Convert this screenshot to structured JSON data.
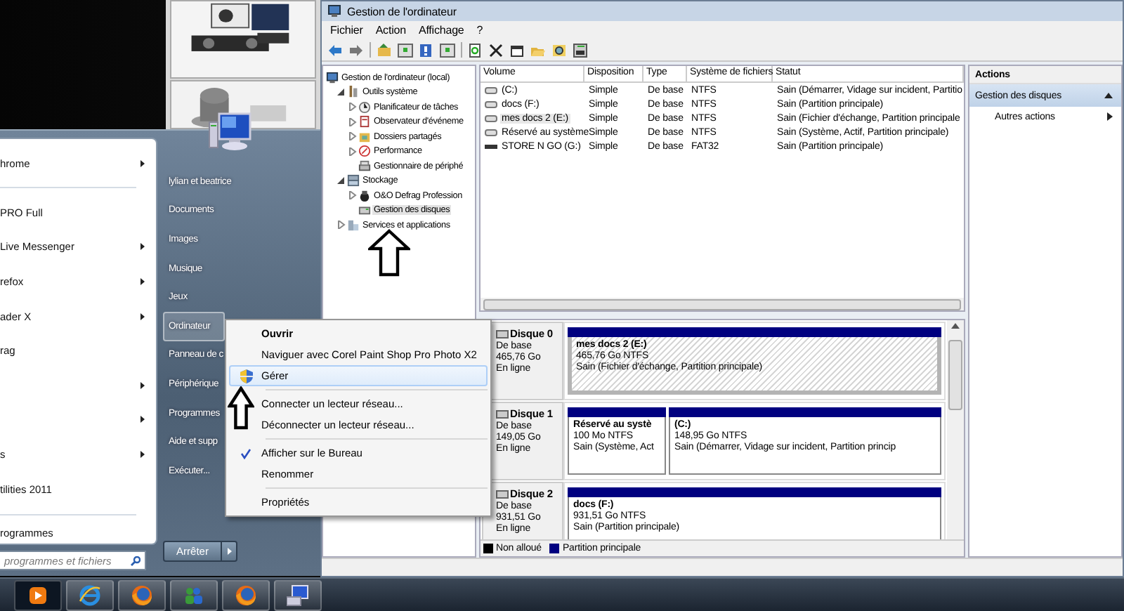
{
  "window": {
    "title": "Gestion de l'ordinateur",
    "menu": [
      "Fichier",
      "Action",
      "Affichage",
      "?"
    ],
    "tree": [
      {
        "label": "Gestion de l'ordinateur (local)",
        "selected": false,
        "children": [
          {
            "label": "Outils système",
            "expanded": true,
            "selected": false,
            "children": [
              {
                "label": "Planificateur de tâches",
                "expanded": false,
                "selected": false
              },
              {
                "label": "Observateur d'événeme",
                "expanded": false,
                "selected": false
              },
              {
                "label": "Dossiers partagés",
                "expanded": false,
                "selected": false
              },
              {
                "label": "Performance",
                "expanded": false,
                "selected": false
              },
              {
                "label": "Gestionnaire de périphé",
                "selected": false
              }
            ]
          },
          {
            "label": "Stockage",
            "expanded": true,
            "selected": false,
            "children": [
              {
                "label": "O&O Defrag Profession",
                "expanded": false,
                "selected": false
              },
              {
                "label": "Gestion des disques",
                "selected": true
              }
            ]
          },
          {
            "label": "Services et applications",
            "expanded": false,
            "selected": false
          }
        ]
      }
    ],
    "table": {
      "columns": [
        "Volume",
        "Disposition",
        "Type",
        "Système de fichiers",
        "Statut"
      ],
      "rows": [
        {
          "kind": "fixed",
          "selected": false,
          "cells": [
            "(C:)",
            "Simple",
            "De base",
            "NTFS",
            "Sain (Démarrer, Vidage sur incident, Partitio"
          ]
        },
        {
          "kind": "fixed",
          "selected": false,
          "cells": [
            "docs (F:)",
            "Simple",
            "De base",
            "NTFS",
            "Sain (Partition principale)"
          ]
        },
        {
          "kind": "fixed",
          "selected": true,
          "cells": [
            "mes docs 2 (E:)",
            "Simple",
            "De base",
            "NTFS",
            "Sain (Fichier d'échange, Partition principale"
          ]
        },
        {
          "kind": "fixed",
          "selected": false,
          "cells": [
            "Réservé au système",
            "Simple",
            "De base",
            "NTFS",
            "Sain (Système, Actif, Partition principale)"
          ]
        },
        {
          "kind": "removable",
          "selected": false,
          "cells": [
            "STORE N GO (G:)",
            "Simple",
            "De base",
            "FAT32",
            "Sain (Partition principale)"
          ]
        }
      ]
    },
    "disks": [
      {
        "name": "Disque 0",
        "lines": [
          "De base",
          "465,76 Go",
          "En ligne"
        ],
        "partitions": [
          {
            "title": "mes docs 2  (E:)",
            "size": "465,76 Go NTFS",
            "status": "Sain (Fichier d'échange, Partition principale)",
            "selected": true
          }
        ]
      },
      {
        "name": "Disque 1",
        "lines": [
          "De base",
          "149,05 Go",
          "En ligne"
        ],
        "partitions": [
          {
            "title": "Réservé au systè",
            "size": "100 Mo NTFS",
            "status": "Sain (Système, Act",
            "selected": false
          },
          {
            "title": "(C:)",
            "size": "148,95 Go NTFS",
            "status": "Sain (Démarrer, Vidage sur incident, Partition princip",
            "selected": false
          }
        ]
      },
      {
        "name": "Disque 2",
        "lines": [
          "De base",
          "931,51 Go",
          "En ligne"
        ],
        "partitions": [
          {
            "title": "docs  (F:)",
            "size": "931,51 Go NTFS",
            "status": "Sain (Partition principale)",
            "selected": false
          }
        ]
      }
    ],
    "legend": [
      {
        "label": "Non alloué",
        "color": "#000000"
      },
      {
        "label": "Partition principale",
        "color": "#000080"
      }
    ],
    "actions": {
      "header": "Actions",
      "items": [
        {
          "kind": "section",
          "label": "Gestion des disques",
          "expanded": true
        },
        {
          "kind": "link",
          "label": "Autres actions"
        }
      ]
    }
  },
  "start_menu": {
    "programs": [
      {
        "kind": "program",
        "label": "hrome",
        "submenu": true
      },
      {
        "kind": "separator"
      },
      {
        "kind": "program",
        "label": "PRO Full",
        "submenu": false
      },
      {
        "kind": "program",
        "label": "Live Messenger",
        "submenu": true
      },
      {
        "kind": "program",
        "label": "refox",
        "submenu": true
      },
      {
        "kind": "program",
        "label": "ader X",
        "submenu": true
      },
      {
        "kind": "program",
        "label": "rag",
        "submenu": false
      },
      {
        "kind": "program",
        "submenu": true
      },
      {
        "kind": "program",
        "submenu": true
      },
      {
        "kind": "program",
        "label": "s",
        "submenu": true
      },
      {
        "kind": "program",
        "label": "tilities 2011",
        "submenu": false
      },
      {
        "kind": "separator"
      },
      {
        "kind": "program",
        "label": "rogrammes",
        "submenu": false
      }
    ],
    "search": {
      "placeholder": "programmes et fichiers"
    },
    "places": [
      {
        "label": "lylian et beatrice",
        "selected": false
      },
      {
        "label": "Documents",
        "selected": false
      },
      {
        "label": "Images",
        "selected": false
      },
      {
        "label": "Musique",
        "selected": false
      },
      {
        "label": "Jeux",
        "selected": false
      },
      {
        "label": "Ordinateur",
        "selected": true
      },
      {
        "label": "Panneau de c",
        "selected": false
      },
      {
        "label": "Périphérique",
        "selected": false
      },
      {
        "label": "Programmes",
        "selected": false
      },
      {
        "label": "Aide et supp",
        "selected": false
      },
      {
        "label": "Exécuter...",
        "selected": false
      }
    ],
    "shutdown": {
      "label": "Arrêter"
    }
  },
  "context_menu": {
    "items": [
      {
        "kind": "item",
        "label": "Ouvrir",
        "default": true,
        "selected": false,
        "checked": false
      },
      {
        "kind": "item",
        "label": "Naviguer avec Corel Paint Shop Pro Photo X2",
        "default": false,
        "selected": false,
        "checked": false
      },
      {
        "kind": "admin",
        "label": "Gérer",
        "default": false,
        "selected": true,
        "checked": false
      },
      {
        "kind": "separator"
      },
      {
        "kind": "item",
        "label": "Connecter un lecteur réseau...",
        "default": false,
        "selected": false,
        "checked": false
      },
      {
        "kind": "item",
        "label": "Déconnecter un lecteur réseau...",
        "default": false,
        "selected": false,
        "checked": false
      },
      {
        "kind": "separator"
      },
      {
        "kind": "item",
        "label": "Afficher sur le Bureau",
        "default": false,
        "selected": false,
        "checked": true
      },
      {
        "kind": "item",
        "label": "Renommer",
        "default": false,
        "selected": false,
        "checked": false
      },
      {
        "kind": "separator"
      },
      {
        "kind": "item",
        "label": "Propriétés",
        "default": false,
        "selected": false,
        "checked": false
      }
    ]
  }
}
